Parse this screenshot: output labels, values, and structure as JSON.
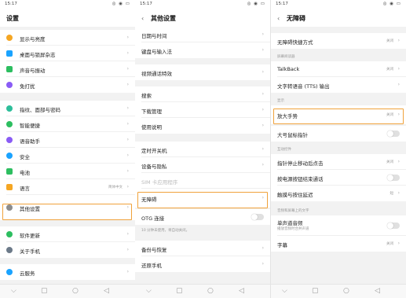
{
  "status": {
    "time": "15:17",
    "icons": "◎ ◉ ▭"
  },
  "nav_icons": {
    "menu": "⌵",
    "square": "▢",
    "circle": "○",
    "back": "◁"
  },
  "screen1": {
    "title": "设置",
    "items": [
      {
        "label": "显示与亮度",
        "icon": "brightness-icon",
        "color": "#f5a623"
      },
      {
        "label": "桌面与锁屏杂志",
        "icon": "desktop-icon",
        "color": "#1aa3ff"
      },
      {
        "label": "声音与振动",
        "icon": "sound-icon",
        "color": "#2dbe60"
      },
      {
        "label": "免打扰",
        "icon": "moon-icon",
        "color": "#8a5cf5"
      },
      {
        "label": "指纹、面部与密码",
        "icon": "fingerprint-icon",
        "color": "#2dbe9a"
      },
      {
        "label": "智能便捷",
        "icon": "smart-icon",
        "color": "#2dbe60"
      },
      {
        "label": "语音助手",
        "icon": "mic-icon",
        "color": "#8a5cf5"
      },
      {
        "label": "安全",
        "icon": "shield-icon",
        "color": "#1aa3ff"
      },
      {
        "label": "电池",
        "icon": "battery-icon",
        "color": "#2dbe60"
      },
      {
        "label": "语言",
        "icon": "language-icon",
        "color": "#f5a623",
        "value": "简体中文"
      },
      {
        "label": "其他设置",
        "icon": "gear-icon",
        "color": "#8c8c8c"
      },
      {
        "label": "软件更新",
        "icon": "update-icon",
        "color": "#2dbe60"
      },
      {
        "label": "关于手机",
        "icon": "info-icon",
        "color": "#6c7a89"
      },
      {
        "label": "云服务",
        "icon": "cloud-icon",
        "color": "#1aa3ff"
      }
    ]
  },
  "screen2": {
    "title": "其他设置",
    "items": [
      {
        "label": "日期与时间"
      },
      {
        "label": "键盘与输入法"
      },
      {
        "label": "视频通话特效"
      },
      {
        "label": "搜索"
      },
      {
        "label": "下载管理"
      },
      {
        "label": "使用说明"
      },
      {
        "label": "定时开关机"
      },
      {
        "label": "设备与隐私"
      },
      {
        "label": "SIM 卡应用程序"
      },
      {
        "label": "无障碍"
      },
      {
        "label": "OTG 连接"
      },
      {
        "label": "备份与恢复"
      },
      {
        "label": "还原手机"
      }
    ],
    "note": "10 分钟未使用，将自动关闭。"
  },
  "screen3": {
    "title": "无障碍",
    "items": [
      {
        "label": "无障碍快捷方式",
        "value": "关闭"
      },
      {
        "label": "TalkBack",
        "value": "关闭"
      },
      {
        "label": "文字转语音 (TTS) 输出"
      },
      {
        "label": "放大手势",
        "value": "关闭"
      },
      {
        "label": "大号鼠标指针"
      },
      {
        "label": "指针停止移动后点击",
        "value": "关闭"
      },
      {
        "label": "按电源按钮结束通话"
      },
      {
        "label": "触摸与按住延迟",
        "value": "短"
      },
      {
        "label": "单声道音频",
        "sub": "播放音频时合并声道"
      },
      {
        "label": "字幕",
        "value": "关闭"
      }
    ],
    "sections": [
      "屏幕阅读器",
      "显示",
      "互动控件",
      "音频和屏幕上的文字"
    ]
  },
  "accent_color": "#f0a23b"
}
